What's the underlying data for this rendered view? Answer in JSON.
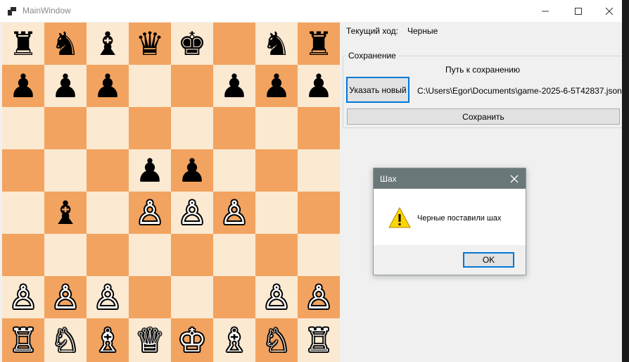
{
  "window": {
    "title": "MainWindow"
  },
  "titlebar": {
    "minimize_glyph": "—",
    "maximize_glyph": "☐",
    "close_glyph": "✕"
  },
  "turn": {
    "label": "Текущий ход:",
    "value": "Черные"
  },
  "save": {
    "group_title": "Сохранение",
    "path_label": "Путь к сохранению",
    "choose_button": "Указать новый",
    "path": "C:\\Users\\Egor\\Documents\\game-2025-6-5T42837.json",
    "save_button": "Сохранить"
  },
  "board": {
    "squares": [
      [
        "♜",
        "♞",
        "♝",
        "♛",
        "♚",
        "",
        "♞",
        "♜"
      ],
      [
        "♟",
        "♟",
        "♟",
        "",
        "",
        "♟",
        "♟",
        "♟"
      ],
      [
        "",
        "",
        "",
        "",
        "",
        "",
        "",
        ""
      ],
      [
        "",
        "",
        "",
        "♟",
        "♟",
        "",
        "",
        ""
      ],
      [
        "",
        "♝",
        "",
        "♙",
        "♙",
        "♙",
        "",
        ""
      ],
      [
        "",
        "",
        "",
        "",
        "",
        "",
        "",
        ""
      ],
      [
        "♙",
        "♙",
        "♙",
        "",
        "",
        "",
        "♙",
        "♙"
      ],
      [
        "♖",
        "♘",
        "♗",
        "♕",
        "♔",
        "♗",
        "♘",
        "♖"
      ]
    ],
    "colors": [
      "b",
      "b",
      "b",
      "b",
      "b",
      "",
      "b",
      "b",
      "b",
      "b",
      "b",
      "",
      "",
      "b",
      "b",
      "b",
      "",
      "",
      "",
      "",
      "",
      "",
      "",
      "",
      "",
      "",
      "",
      "b",
      "b",
      "",
      "",
      "",
      "",
      "b",
      "",
      "w",
      "w",
      "w",
      "",
      "",
      "",
      "",
      "",
      "",
      "",
      "",
      "",
      "",
      "w",
      "w",
      "w",
      "",
      "",
      "",
      "w",
      "w",
      "w",
      "w",
      "w",
      "w",
      "w",
      "w",
      "w",
      "w"
    ],
    "light_color": "#fbe9d2",
    "dark_color": "#f2a35f"
  },
  "dialog": {
    "title": "Шах",
    "message": "Черные поставили шах",
    "ok_button": "OK",
    "icon": "warning-icon"
  }
}
